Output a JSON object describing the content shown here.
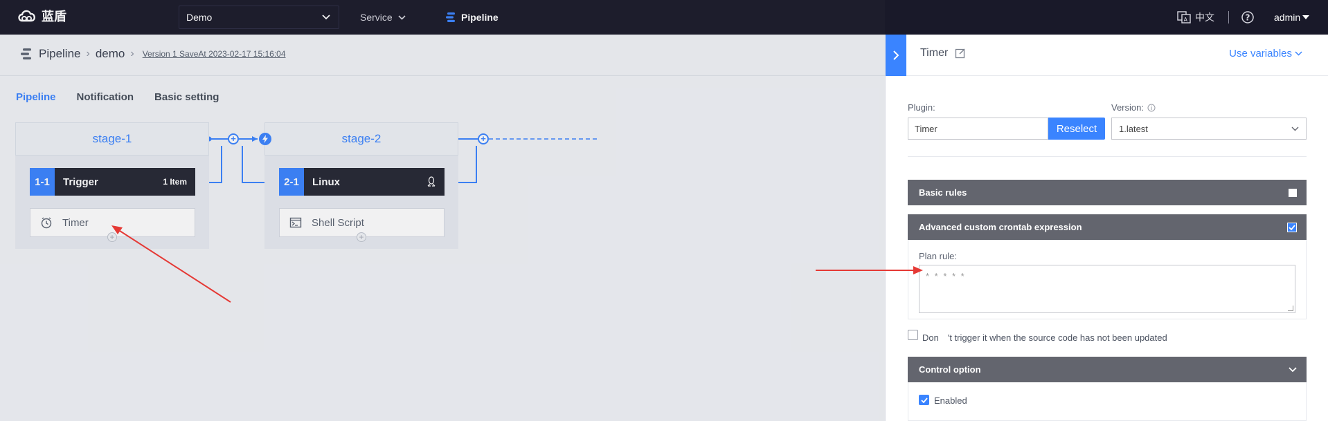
{
  "topnav": {
    "logo_text": "蓝盾",
    "project": "Demo",
    "service_label": "Service",
    "pipeline_label": "Pipeline",
    "lang_label": "中文",
    "user_label": "admin"
  },
  "breadcrumb": {
    "root": "Pipeline",
    "pipeline_name": "demo",
    "version": "Version 1 SaveAt 2023-02-17 15:16:04"
  },
  "tabs": [
    {
      "label": "Pipeline",
      "active": true
    },
    {
      "label": "Notification",
      "active": false
    },
    {
      "label": "Basic setting",
      "active": false
    }
  ],
  "stages": [
    {
      "title": "stage-1",
      "job": {
        "num": "1-1",
        "name": "Trigger",
        "count": "1 Item"
      },
      "element": {
        "name": "Timer",
        "icon": "clock-icon"
      }
    },
    {
      "title": "stage-2",
      "job": {
        "num": "2-1",
        "name": "Linux",
        "os_icon": "linux-icon"
      },
      "element": {
        "name": "Shell Script",
        "icon": "terminal-icon"
      }
    }
  ],
  "panel": {
    "title": "Timer",
    "use_variables": "Use variables",
    "plugin_label": "Plugin:",
    "plugin_value": "Timer",
    "reselect_label": "Reselect",
    "version_label": "Version:",
    "version_value": "1.latest",
    "basic_rules_label": "Basic rules",
    "basic_rules_checked": false,
    "advanced_label": "Advanced custom crontab expression",
    "advanced_checked": true,
    "plan_rule_label": "Plan rule:",
    "plan_rule_placeholder": "* * * * *",
    "no_trigger_label": "Don　't trigger it when the source code has not been updated",
    "no_trigger_checked": false,
    "control_option_label": "Control option",
    "enabled_label": "Enabled",
    "enabled_checked": true
  },
  "colors": {
    "accent": "#3a84ff",
    "topnav_bg": "#191929",
    "section_bar": "#63656e",
    "annotation_arrow": "#e53935"
  }
}
